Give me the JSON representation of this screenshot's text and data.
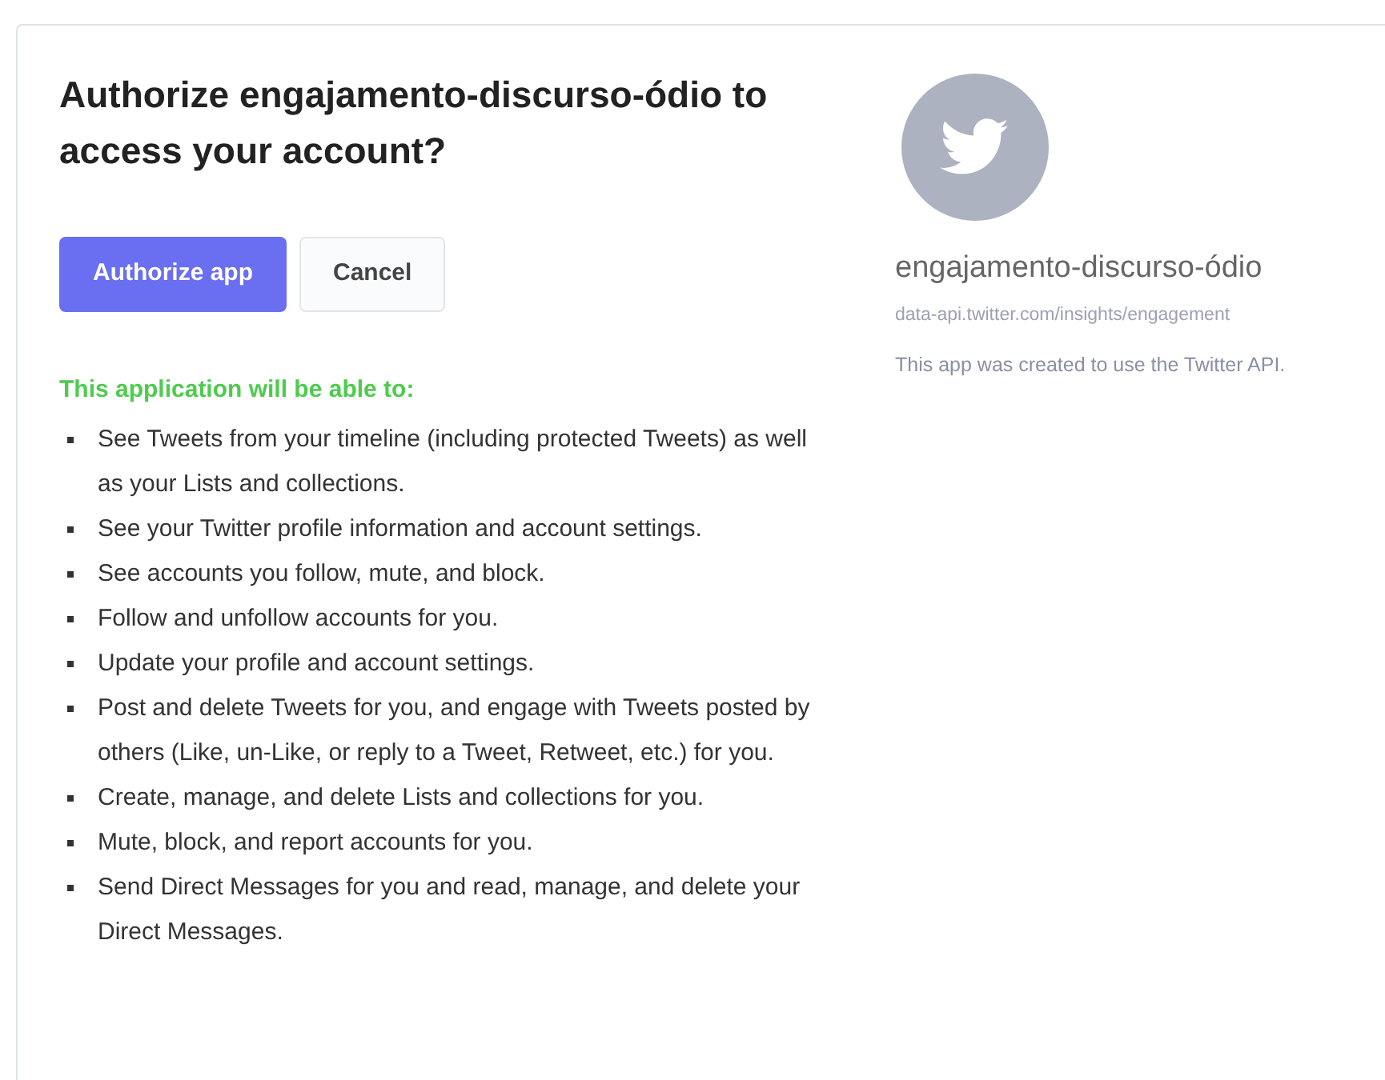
{
  "heading": "Authorize engajamento-discurso-ódio to access your account?",
  "buttons": [
    {
      "label": "Authorize app",
      "kind": "primary"
    },
    {
      "label": "Cancel",
      "kind": "secondary"
    }
  ],
  "permissions_title": "This application will be able to:",
  "permissions": [
    "See Tweets from your timeline (including protected Tweets) as well as your Lists and collections.",
    "See your Twitter profile information and account settings.",
    "See accounts you follow, mute, and block.",
    "Follow and unfollow accounts for you.",
    "Update your profile and account settings.",
    "Post and delete Tweets for you, and engage with Tweets posted by others (Like, un-Like, or reply to a Tweet, Retweet, etc.) for you.",
    "Create, manage, and delete Lists and collections for you.",
    "Mute, block, and report accounts for you.",
    "Send Direct Messages for you and read, manage, and delete your Direct Messages."
  ],
  "app": {
    "name": "engajamento-discurso-ódio",
    "url": "data-api.twitter.com/insights/engagement",
    "description": "This app was created to use the Twitter API."
  }
}
